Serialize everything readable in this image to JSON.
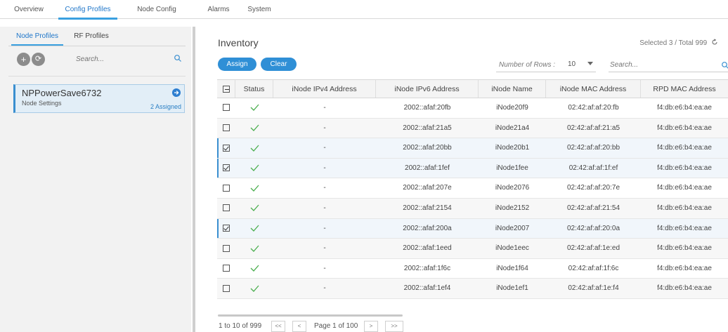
{
  "topnav": {
    "tabs": [
      "Overview",
      "Config Profiles",
      "Node Config",
      "Alarms",
      "System"
    ],
    "active": "Config Profiles"
  },
  "left": {
    "subtabs": [
      "Node Profiles",
      "RF Profiles"
    ],
    "active_subtab": "Node Profiles",
    "add_symbol": "+",
    "refresh_symbol": "⟳",
    "search_placeholder": "Search...",
    "profile": {
      "name": "NPPowerSave6732",
      "subtitle": "Node Settings",
      "assigned": "2 Assigned"
    }
  },
  "main": {
    "title": "Inventory",
    "selected_total": "Selected 3 / Total 999",
    "assign_label": "Assign",
    "clear_label": "Clear",
    "rows_label": "Number of Rows :",
    "rows_value": "10",
    "search_placeholder": "Search...",
    "columns": [
      "Status",
      "iNode IPv4 Address",
      "iNode IPv6 Address",
      "iNode Name",
      "iNode MAC Address",
      "RPD MAC Address"
    ],
    "rows": [
      {
        "checked": false,
        "ipv4": "-",
        "ipv6": "2002::afaf:20fb",
        "name": "iNode20f9",
        "mac": "02:42:af:af:20:fb",
        "rpd": "f4:db:e6:b4:ea:ae"
      },
      {
        "checked": false,
        "ipv4": "-",
        "ipv6": "2002::afaf:21a5",
        "name": "iNode21a4",
        "mac": "02:42:af:af:21:a5",
        "rpd": "f4:db:e6:b4:ea:ae"
      },
      {
        "checked": true,
        "ipv4": "-",
        "ipv6": "2002::afaf:20bb",
        "name": "iNode20b1",
        "mac": "02:42:af:af:20:bb",
        "rpd": "f4:db:e6:b4:ea:ae"
      },
      {
        "checked": true,
        "ipv4": "-",
        "ipv6": "2002::afaf:1fef",
        "name": "iNode1fee",
        "mac": "02:42:af:af:1f:ef",
        "rpd": "f4:db:e6:b4:ea:ae"
      },
      {
        "checked": false,
        "ipv4": "-",
        "ipv6": "2002::afaf:207e",
        "name": "iNode2076",
        "mac": "02:42:af:af:20:7e",
        "rpd": "f4:db:e6:b4:ea:ae"
      },
      {
        "checked": false,
        "ipv4": "-",
        "ipv6": "2002::afaf:2154",
        "name": "iNode2152",
        "mac": "02:42:af:af:21:54",
        "rpd": "f4:db:e6:b4:ea:ae"
      },
      {
        "checked": true,
        "ipv4": "-",
        "ipv6": "2002::afaf:200a",
        "name": "iNode2007",
        "mac": "02:42:af:af:20:0a",
        "rpd": "f4:db:e6:b4:ea:ae"
      },
      {
        "checked": false,
        "ipv4": "-",
        "ipv6": "2002::afaf:1eed",
        "name": "iNode1eec",
        "mac": "02:42:af:af:1e:ed",
        "rpd": "f4:db:e6:b4:ea:ae"
      },
      {
        "checked": false,
        "ipv4": "-",
        "ipv6": "2002::afaf:1f6c",
        "name": "iNode1f64",
        "mac": "02:42:af:af:1f:6c",
        "rpd": "f4:db:e6:b4:ea:ae"
      },
      {
        "checked": false,
        "ipv4": "-",
        "ipv6": "2002::afaf:1ef4",
        "name": "iNode1ef1",
        "mac": "02:42:af:af:1e:f4",
        "rpd": "f4:db:e6:b4:ea:ae"
      }
    ],
    "pager": {
      "info": "1 to 10 of 999",
      "first": "<<",
      "prev": "<",
      "page_text": "Page 1 of 100",
      "next": ">",
      "last": ">>"
    }
  },
  "colors": {
    "accent": "#2f8fd6",
    "status_ok": "#4caf50"
  }
}
